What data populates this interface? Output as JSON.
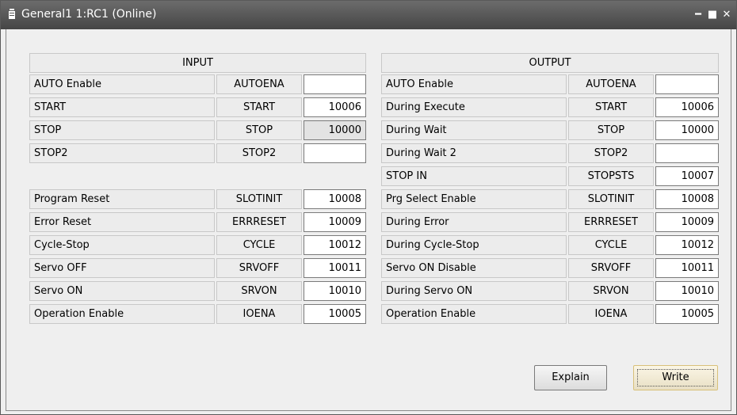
{
  "window": {
    "title": "General1 1:RC1 (Online)"
  },
  "input": {
    "header": "INPUT",
    "rows": [
      {
        "label": "AUTO Enable",
        "code": "AUTOENA",
        "value": ""
      },
      {
        "label": "START",
        "code": "START",
        "value": "10006"
      },
      {
        "label": "STOP",
        "code": "STOP",
        "value": "10000"
      },
      {
        "label": "STOP2",
        "code": "STOP2",
        "value": ""
      },
      {
        "label": "Program Reset",
        "code": "SLOTINIT",
        "value": "10008"
      },
      {
        "label": "Error Reset",
        "code": "ERRRESET",
        "value": "10009"
      },
      {
        "label": "Cycle-Stop",
        "code": "CYCLE",
        "value": "10012"
      },
      {
        "label": "Servo OFF",
        "code": "SRVOFF",
        "value": "10011"
      },
      {
        "label": "Servo ON",
        "code": "SRVON",
        "value": "10010"
      },
      {
        "label": "Operation Enable",
        "code": "IOENA",
        "value": "10005"
      }
    ]
  },
  "output": {
    "header": "OUTPUT",
    "rows": [
      {
        "label": "AUTO Enable",
        "code": "AUTOENA",
        "value": ""
      },
      {
        "label": "During Execute",
        "code": "START",
        "value": "10006"
      },
      {
        "label": "During Wait",
        "code": "STOP",
        "value": "10000"
      },
      {
        "label": "During Wait 2",
        "code": "STOP2",
        "value": ""
      },
      {
        "label": "STOP IN",
        "code": "STOPSTS",
        "value": "10007"
      },
      {
        "label": "Prg Select Enable",
        "code": "SLOTINIT",
        "value": "10008"
      },
      {
        "label": "During Error",
        "code": "ERRRESET",
        "value": "10009"
      },
      {
        "label": "During Cycle-Stop",
        "code": "CYCLE",
        "value": "10012"
      },
      {
        "label": "Servo ON Disable",
        "code": "SRVOFF",
        "value": "10011"
      },
      {
        "label": "During Servo ON",
        "code": "SRVON",
        "value": "10010"
      },
      {
        "label": "Operation Enable",
        "code": "IOENA",
        "value": "10005"
      }
    ]
  },
  "buttons": {
    "explain": "Explain",
    "write": "Write"
  }
}
